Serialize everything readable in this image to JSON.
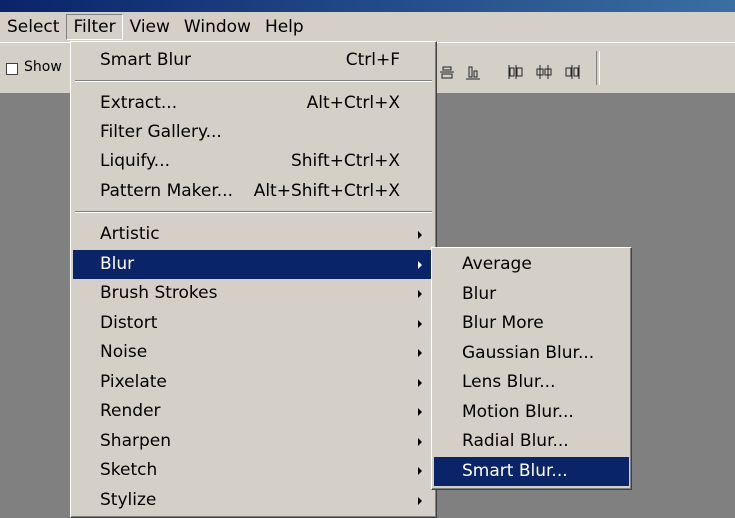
{
  "menubar": {
    "items": [
      {
        "label": "Select"
      },
      {
        "label": "Filter",
        "active": true
      },
      {
        "label": "View"
      },
      {
        "label": "Window"
      },
      {
        "label": "Help"
      }
    ]
  },
  "options_bar": {
    "show_label": "Show",
    "show_checked": false
  },
  "filter_menu": {
    "last_filter": {
      "label": "Smart Blur",
      "shortcut": "Ctrl+F"
    },
    "group2": [
      {
        "label": "Extract...",
        "shortcut": "Alt+Ctrl+X"
      },
      {
        "label": "Filter Gallery...",
        "shortcut": ""
      },
      {
        "label": "Liquify...",
        "shortcut": "Shift+Ctrl+X"
      },
      {
        "label": "Pattern Maker...",
        "shortcut": "Alt+Shift+Ctrl+X"
      }
    ],
    "categories": [
      {
        "label": "Artistic"
      },
      {
        "label": "Blur",
        "highlighted": true
      },
      {
        "label": "Brush Strokes"
      },
      {
        "label": "Distort"
      },
      {
        "label": "Noise"
      },
      {
        "label": "Pixelate"
      },
      {
        "label": "Render"
      },
      {
        "label": "Sharpen"
      },
      {
        "label": "Sketch"
      },
      {
        "label": "Stylize"
      }
    ]
  },
  "blur_submenu": {
    "items": [
      {
        "label": "Average"
      },
      {
        "label": "Blur"
      },
      {
        "label": "Blur More"
      },
      {
        "label": "Gaussian Blur..."
      },
      {
        "label": "Lens Blur..."
      },
      {
        "label": "Motion Blur..."
      },
      {
        "label": "Radial Blur..."
      },
      {
        "label": "Smart Blur...",
        "highlighted": true
      }
    ]
  },
  "colors": {
    "menu_bg": "#d4d0c8",
    "highlight": "#0a246a",
    "workspace": "#808080"
  }
}
